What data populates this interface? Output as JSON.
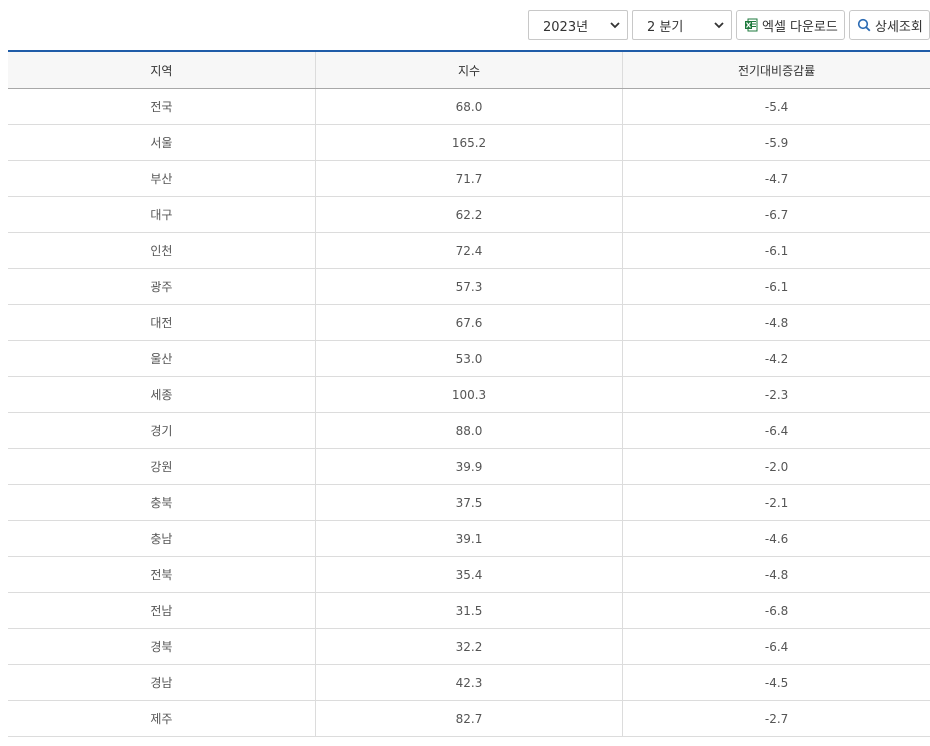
{
  "toolbar": {
    "year_value": "2023년",
    "quarter_value": "2 분기",
    "excel_label": "엑셀 다운로드",
    "detail_label": "상세조회"
  },
  "table": {
    "headers": [
      "지역",
      "지수",
      "전기대비증감률"
    ],
    "rows": [
      [
        "전국",
        "68.0",
        "-5.4"
      ],
      [
        "서울",
        "165.2",
        "-5.9"
      ],
      [
        "부산",
        "71.7",
        "-4.7"
      ],
      [
        "대구",
        "62.2",
        "-6.7"
      ],
      [
        "인천",
        "72.4",
        "-6.1"
      ],
      [
        "광주",
        "57.3",
        "-6.1"
      ],
      [
        "대전",
        "67.6",
        "-4.8"
      ],
      [
        "울산",
        "53.0",
        "-4.2"
      ],
      [
        "세종",
        "100.3",
        "-2.3"
      ],
      [
        "경기",
        "88.0",
        "-6.4"
      ],
      [
        "강원",
        "39.9",
        "-2.0"
      ],
      [
        "충북",
        "37.5",
        "-2.1"
      ],
      [
        "충남",
        "39.1",
        "-4.6"
      ],
      [
        "전북",
        "35.4",
        "-4.8"
      ],
      [
        "전남",
        "31.5",
        "-6.8"
      ],
      [
        "경북",
        "32.2",
        "-6.4"
      ],
      [
        "경남",
        "42.3",
        "-4.5"
      ],
      [
        "제주",
        "82.7",
        "-2.7"
      ]
    ]
  },
  "colors": {
    "header_rule": "#1f5ca8",
    "excel_icon": "#1e7a3c",
    "search_icon": "#2a6ab3"
  }
}
